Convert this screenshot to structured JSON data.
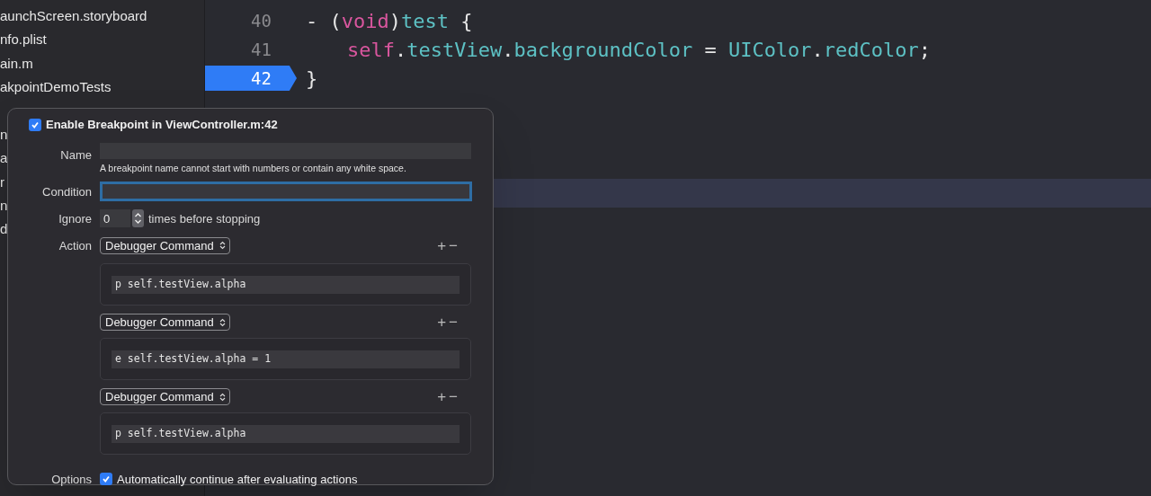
{
  "sidebar": {
    "items": [
      {
        "label": "aunchScreen.storyboard"
      },
      {
        "label": "nfo.plist"
      },
      {
        "label": "ain.m"
      },
      {
        "label": "akpointDemoTests"
      },
      {
        "label": "n"
      },
      {
        "label": "a"
      },
      {
        "label": "r"
      },
      {
        "label": "n"
      },
      {
        "label": "d"
      }
    ]
  },
  "editor": {
    "lines": [
      {
        "number": "40",
        "breakpoint": false,
        "current": false,
        "indented": false,
        "code": [
          {
            "text": "- (",
            "kind": "plain"
          },
          {
            "text": "void",
            "kind": "keyword"
          },
          {
            "text": ")",
            "kind": "plain"
          },
          {
            "text": "test",
            "kind": "name"
          },
          {
            "text": " {",
            "kind": "plain"
          }
        ]
      },
      {
        "number": "41",
        "breakpoint": false,
        "current": false,
        "indented": true,
        "code": [
          {
            "text": "self",
            "kind": "keyword"
          },
          {
            "text": ".",
            "kind": "plain"
          },
          {
            "text": "testView",
            "kind": "name"
          },
          {
            "text": ".",
            "kind": "plain"
          },
          {
            "text": "backgroundColor",
            "kind": "name"
          },
          {
            "text": " = ",
            "kind": "plain"
          },
          {
            "text": "UIColor",
            "kind": "name"
          },
          {
            "text": ".",
            "kind": "plain"
          },
          {
            "text": "redColor",
            "kind": "name"
          },
          {
            "text": ";",
            "kind": "plain"
          }
        ]
      },
      {
        "number": "42",
        "breakpoint": true,
        "current": false,
        "indented": false,
        "code": [
          {
            "text": "}",
            "kind": "plain"
          }
        ]
      },
      {
        "current": false
      },
      {
        "current": false
      },
      {
        "current": false
      },
      {
        "current": true
      }
    ]
  },
  "popover": {
    "enabled": true,
    "title": "Enable Breakpoint in ViewController.m:42",
    "name": {
      "label": "Name",
      "hint": "A breakpoint name cannot start with numbers or contain any white space."
    },
    "condition": {
      "label": "Condition",
      "focused": true
    },
    "ignore": {
      "label": "Ignore",
      "value": "0",
      "suffix": "times before stopping"
    },
    "action_label": "Action",
    "actions": [
      {
        "type": "Debugger Command",
        "command": "p self.testView.alpha",
        "add": "+",
        "remove": "−"
      },
      {
        "type": "Debugger Command",
        "command": "e self.testView.alpha = 1",
        "add": "+",
        "remove": "−"
      },
      {
        "type": "Debugger Command",
        "command": "p self.testView.alpha",
        "add": "+",
        "remove": "−"
      }
    ],
    "options": {
      "label": "Options",
      "checked": true,
      "text": "Automatically continue after evaluating actions"
    }
  }
}
